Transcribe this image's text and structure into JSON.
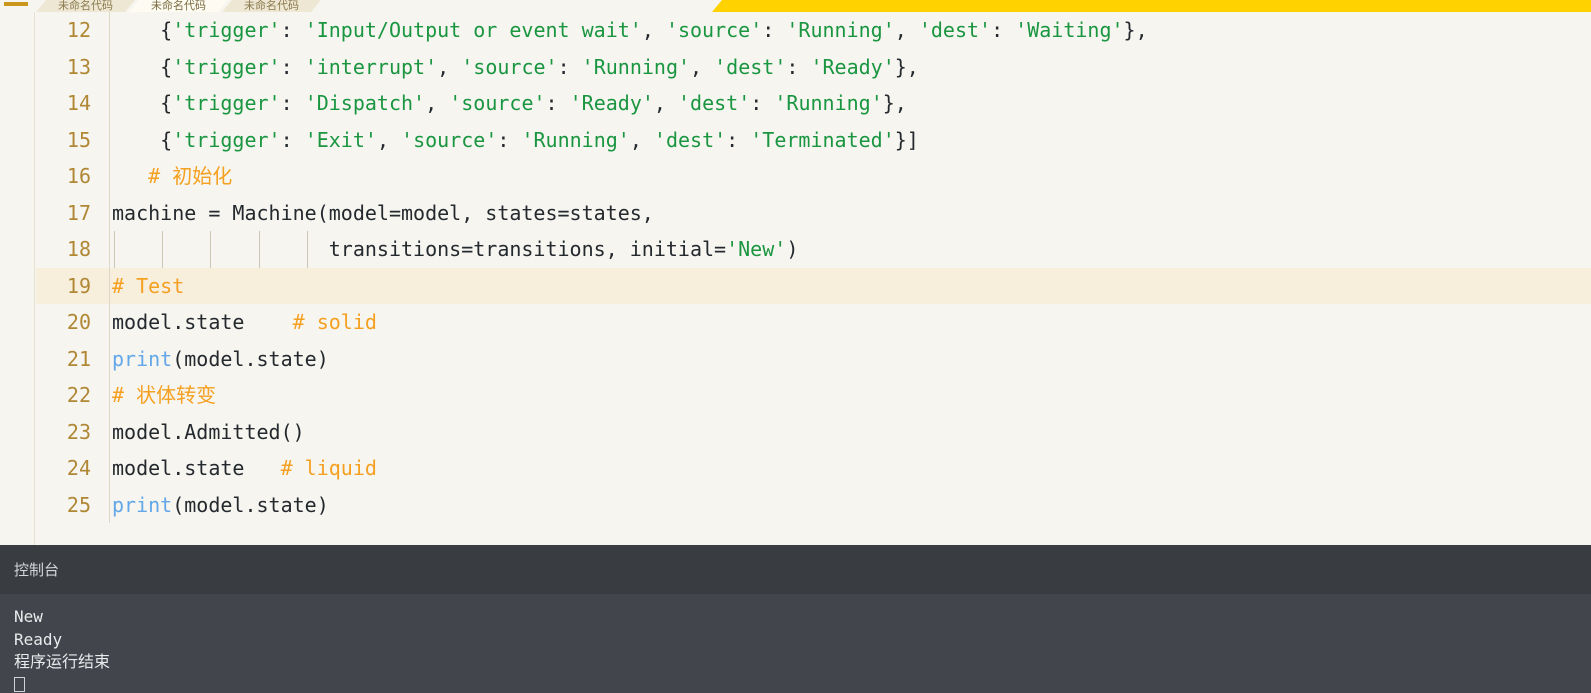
{
  "window": {
    "menu_icon": "hamburger-menu-icon",
    "accent_yellow": "#ffd200",
    "editor_bg": "#f6f5f0",
    "current_line_bg": "#f7eedc",
    "console_header_bg": "#393c41",
    "console_body_bg": "#42464c"
  },
  "tabs": [
    {
      "label": "未命名代码",
      "active": false
    },
    {
      "label": "未命名代码",
      "active": true
    },
    {
      "label": "未命名代码",
      "active": false
    }
  ],
  "editor": {
    "first_visible_line": 12,
    "current_line": 19,
    "lines": [
      {
        "number": "12",
        "indent_guides": 0,
        "tokens": [
          {
            "t": "plain",
            "s": "    {"
          },
          {
            "t": "str",
            "s": "'trigger'"
          },
          {
            "t": "plain",
            "s": ": "
          },
          {
            "t": "str",
            "s": "'Input/Output or event wait'"
          },
          {
            "t": "plain",
            "s": ", "
          },
          {
            "t": "str",
            "s": "'source'"
          },
          {
            "t": "plain",
            "s": ": "
          },
          {
            "t": "str",
            "s": "'Running'"
          },
          {
            "t": "plain",
            "s": ", "
          },
          {
            "t": "str",
            "s": "'dest'"
          },
          {
            "t": "plain",
            "s": ": "
          },
          {
            "t": "str",
            "s": "'Waiting'"
          },
          {
            "t": "plain",
            "s": "},"
          }
        ]
      },
      {
        "number": "13",
        "indent_guides": 0,
        "tokens": [
          {
            "t": "plain",
            "s": "    {"
          },
          {
            "t": "str",
            "s": "'trigger'"
          },
          {
            "t": "plain",
            "s": ": "
          },
          {
            "t": "str",
            "s": "'interrupt'"
          },
          {
            "t": "plain",
            "s": ", "
          },
          {
            "t": "str",
            "s": "'source'"
          },
          {
            "t": "plain",
            "s": ": "
          },
          {
            "t": "str",
            "s": "'Running'"
          },
          {
            "t": "plain",
            "s": ", "
          },
          {
            "t": "str",
            "s": "'dest'"
          },
          {
            "t": "plain",
            "s": ": "
          },
          {
            "t": "str",
            "s": "'Ready'"
          },
          {
            "t": "plain",
            "s": "},"
          }
        ]
      },
      {
        "number": "14",
        "indent_guides": 0,
        "tokens": [
          {
            "t": "plain",
            "s": "    {"
          },
          {
            "t": "str",
            "s": "'trigger'"
          },
          {
            "t": "plain",
            "s": ": "
          },
          {
            "t": "str",
            "s": "'Dispatch'"
          },
          {
            "t": "plain",
            "s": ", "
          },
          {
            "t": "str",
            "s": "'source'"
          },
          {
            "t": "plain",
            "s": ": "
          },
          {
            "t": "str",
            "s": "'Ready'"
          },
          {
            "t": "plain",
            "s": ", "
          },
          {
            "t": "str",
            "s": "'dest'"
          },
          {
            "t": "plain",
            "s": ": "
          },
          {
            "t": "str",
            "s": "'Running'"
          },
          {
            "t": "plain",
            "s": "},"
          }
        ]
      },
      {
        "number": "15",
        "indent_guides": 0,
        "tokens": [
          {
            "t": "plain",
            "s": "    {"
          },
          {
            "t": "str",
            "s": "'trigger'"
          },
          {
            "t": "plain",
            "s": ": "
          },
          {
            "t": "str",
            "s": "'Exit'"
          },
          {
            "t": "plain",
            "s": ", "
          },
          {
            "t": "str",
            "s": "'source'"
          },
          {
            "t": "plain",
            "s": ": "
          },
          {
            "t": "str",
            "s": "'Running'"
          },
          {
            "t": "plain",
            "s": ", "
          },
          {
            "t": "str",
            "s": "'dest'"
          },
          {
            "t": "plain",
            "s": ": "
          },
          {
            "t": "str",
            "s": "'Terminated'"
          },
          {
            "t": "plain",
            "s": "}]"
          }
        ]
      },
      {
        "number": "16",
        "indent_guides": 0,
        "tokens": [
          {
            "t": "cmt",
            "s": "   # 初始化"
          }
        ]
      },
      {
        "number": "17",
        "indent_guides": 0,
        "tokens": [
          {
            "t": "plain",
            "s": "machine = Machine(model=model, states=states,"
          }
        ]
      },
      {
        "number": "18",
        "indent_guides": 5,
        "tokens": [
          {
            "t": "plain",
            "s": "                  transitions=transitions, initial="
          },
          {
            "t": "str",
            "s": "'New'"
          },
          {
            "t": "plain",
            "s": ")"
          }
        ]
      },
      {
        "number": "19",
        "indent_guides": 0,
        "current": true,
        "tokens": [
          {
            "t": "cmt",
            "s": "# Test"
          }
        ]
      },
      {
        "number": "20",
        "indent_guides": 0,
        "tokens": [
          {
            "t": "plain",
            "s": "model.state"
          },
          {
            "t": "cmt",
            "s": "    # solid"
          }
        ]
      },
      {
        "number": "21",
        "indent_guides": 0,
        "tokens": [
          {
            "t": "fn",
            "s": "print"
          },
          {
            "t": "plain",
            "s": "(model.state)"
          }
        ]
      },
      {
        "number": "22",
        "indent_guides": 0,
        "tokens": [
          {
            "t": "cmt",
            "s": "# 状体转变"
          }
        ]
      },
      {
        "number": "23",
        "indent_guides": 0,
        "tokens": [
          {
            "t": "plain",
            "s": "model.Admitted()"
          }
        ]
      },
      {
        "number": "24",
        "indent_guides": 0,
        "tokens": [
          {
            "t": "plain",
            "s": "model.state"
          },
          {
            "t": "cmt",
            "s": "   # liquid"
          }
        ]
      },
      {
        "number": "25",
        "indent_guides": 0,
        "tokens": [
          {
            "t": "fn",
            "s": "print"
          },
          {
            "t": "plain",
            "s": "(model.state)"
          }
        ]
      }
    ]
  },
  "console": {
    "title": "控制台",
    "output": [
      "New",
      "Ready",
      "程序运行结束"
    ],
    "cursor": "block-cursor"
  }
}
